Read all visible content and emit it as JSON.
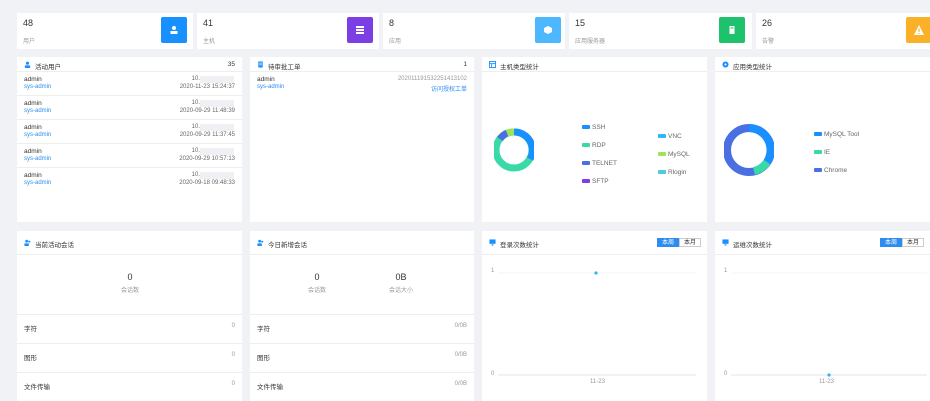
{
  "stats": [
    {
      "value": "48",
      "label": "用户",
      "color": "#1890ff",
      "icon": "user-icon"
    },
    {
      "value": "41",
      "label": "主机",
      "color": "#7b3fe4",
      "icon": "server-icon"
    },
    {
      "value": "8",
      "label": "应用",
      "color": "#4db8ff",
      "icon": "cube-icon"
    },
    {
      "value": "15",
      "label": "应用服务器",
      "color": "#1ec26d",
      "icon": "app-server-icon"
    },
    {
      "value": "26",
      "label": "告警",
      "color": "#fab128",
      "icon": "warning-icon"
    }
  ],
  "active_users": {
    "title": "活动用户",
    "count": "35",
    "rows": [
      {
        "name": "admin",
        "role": "sys-admin",
        "ip": "10.",
        "time": "2020-11-23 15:24:37"
      },
      {
        "name": "admin",
        "role": "sys-admin",
        "ip": "10.",
        "time": "2020-09-29 11:48:39"
      },
      {
        "name": "admin",
        "role": "sys-admin",
        "ip": "10.",
        "time": "2020-09-29 11:37:45"
      },
      {
        "name": "admin",
        "role": "sys-admin",
        "ip": "10.",
        "time": "2020-09-29 10:57:13"
      },
      {
        "name": "admin",
        "role": "sys-admin",
        "ip": "10.",
        "time": "2020-09-18 09:48:33"
      }
    ]
  },
  "pending": {
    "title": "待审批工单",
    "count": "1",
    "rows": [
      {
        "name": "admin",
        "role": "sys-admin",
        "id": "20201119153225141310​2",
        "type": "访问授权工单"
      }
    ]
  },
  "host_types": {
    "title": "主机类型统计",
    "legend_left": [
      {
        "name": "SSH",
        "color": "#1890ff"
      },
      {
        "name": "RDP",
        "color": "#3ad9a8"
      },
      {
        "name": "TELNET",
        "color": "#4a6fe3"
      },
      {
        "name": "SFTP",
        "color": "#7b3fe4"
      }
    ],
    "legend_right": [
      {
        "name": "VNC",
        "color": "#2db7f5"
      },
      {
        "name": "MySQL",
        "color": "#a0e35a"
      },
      {
        "name": "Rlogin",
        "color": "#4ecbe0"
      }
    ]
  },
  "app_types": {
    "title": "应用类型统计",
    "legend": [
      {
        "name": "MySQL Tool",
        "color": "#1890ff"
      },
      {
        "name": "IE",
        "color": "#3ad9a8"
      },
      {
        "name": "Chrome",
        "color": "#4a6fe3"
      }
    ]
  },
  "current_sessions": {
    "title": "当前活动会话",
    "value": "0",
    "label": "会话数",
    "rows": [
      {
        "k": "字符",
        "v": "0"
      },
      {
        "k": "图形",
        "v": "0"
      },
      {
        "k": "文件传输",
        "v": "0"
      }
    ]
  },
  "today_sessions": {
    "title": "今日新增会话",
    "value1": "0",
    "label1": "会话数",
    "value2": "0B",
    "label2": "会话大小",
    "rows": [
      {
        "k": "字符",
        "v": "0/0B"
      },
      {
        "k": "图形",
        "v": "0/0B"
      },
      {
        "k": "文件传输",
        "v": "0/0B"
      }
    ]
  },
  "login_stats": {
    "title": "登录次数统计",
    "btn_week": "本周",
    "btn_month": "本月",
    "y_top": "1",
    "y_bottom": "0",
    "x_label": "11-23"
  },
  "ops_stats": {
    "title": "运维次数统计",
    "btn_week": "本周",
    "btn_month": "本月",
    "y_top": "1",
    "y_bottom": "0",
    "x_label": "11-23"
  }
}
